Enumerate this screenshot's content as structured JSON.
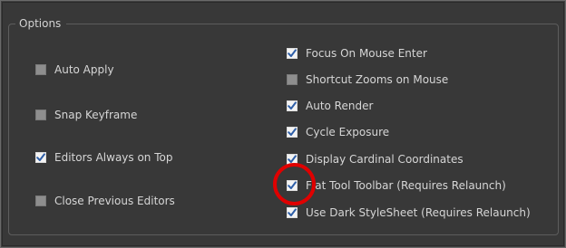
{
  "dialog": {
    "group_title": "Options"
  },
  "options_left": [
    {
      "label": "Auto Apply",
      "checked": false
    },
    {
      "label": "Snap Keyframe",
      "checked": false
    },
    {
      "label": "Editors Always on Top",
      "checked": true
    },
    {
      "label": "Close Previous Editors",
      "checked": false
    }
  ],
  "options_right": [
    {
      "label": "Focus On Mouse Enter",
      "checked": true
    },
    {
      "label": "Shortcut Zooms on Mouse",
      "checked": false
    },
    {
      "label": "Auto Render",
      "checked": true
    },
    {
      "label": "Cycle Exposure",
      "checked": true
    },
    {
      "label": "Display Cardinal Coordinates",
      "checked": true
    },
    {
      "label": "Flat Tool Toolbar (Requires Relaunch)",
      "checked": true
    },
    {
      "label": "Use Dark StyleSheet (Requires Relaunch)",
      "checked": true
    }
  ],
  "colors": {
    "highlight_circle": "#e00000",
    "check_mark": "#2f5fa8"
  }
}
